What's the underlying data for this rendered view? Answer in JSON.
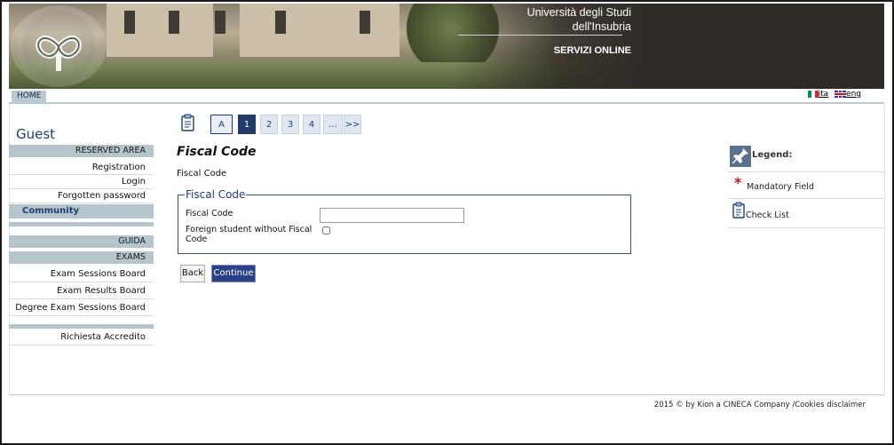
{
  "header": {
    "university_line1": "Università degli Studi",
    "university_line2": "dell'Insubria",
    "services": "SERVIZI ONLINE"
  },
  "navbar": {
    "home": "HOME",
    "lang_it": "ita",
    "lang_en": "eng"
  },
  "sidebar": {
    "guest": "Guest",
    "reserved_area": "RESERVED AREA",
    "registration": "Registration",
    "login": "Login",
    "forgotten_password": "Forgotten password",
    "community": "Community",
    "guida": "GUIDA",
    "exams": "EXAMS",
    "exam_sessions_board": "Exam Sessions Board",
    "exam_results_board": "Exam Results Board",
    "degree_exam_sessions_board": "Degree Exam Sessions Board",
    "richiesta_accredito": "Richiesta Accredito"
  },
  "pager": {
    "a": "A",
    "p1": "1",
    "p2": "2",
    "p3": "3",
    "p4": "4",
    "ellipsis": "…",
    "next": ">>"
  },
  "main": {
    "title": "Fiscal Code",
    "subtitle": "Fiscal Code",
    "fieldset_legend": "Fiscal Code",
    "fiscal_code_label": "Fiscal Code",
    "fiscal_code_value": "",
    "foreign_label": "Foreign student without Fiscal Code",
    "foreign_checked": false,
    "back": "Back",
    "continue": "Continue"
  },
  "legend": {
    "title": "Legend:",
    "mandatory": "Mandatory Field",
    "checklist": "Check List"
  },
  "footer": {
    "text": "2015 © by Kion a CINECA Company /Cookies disclaimer"
  }
}
